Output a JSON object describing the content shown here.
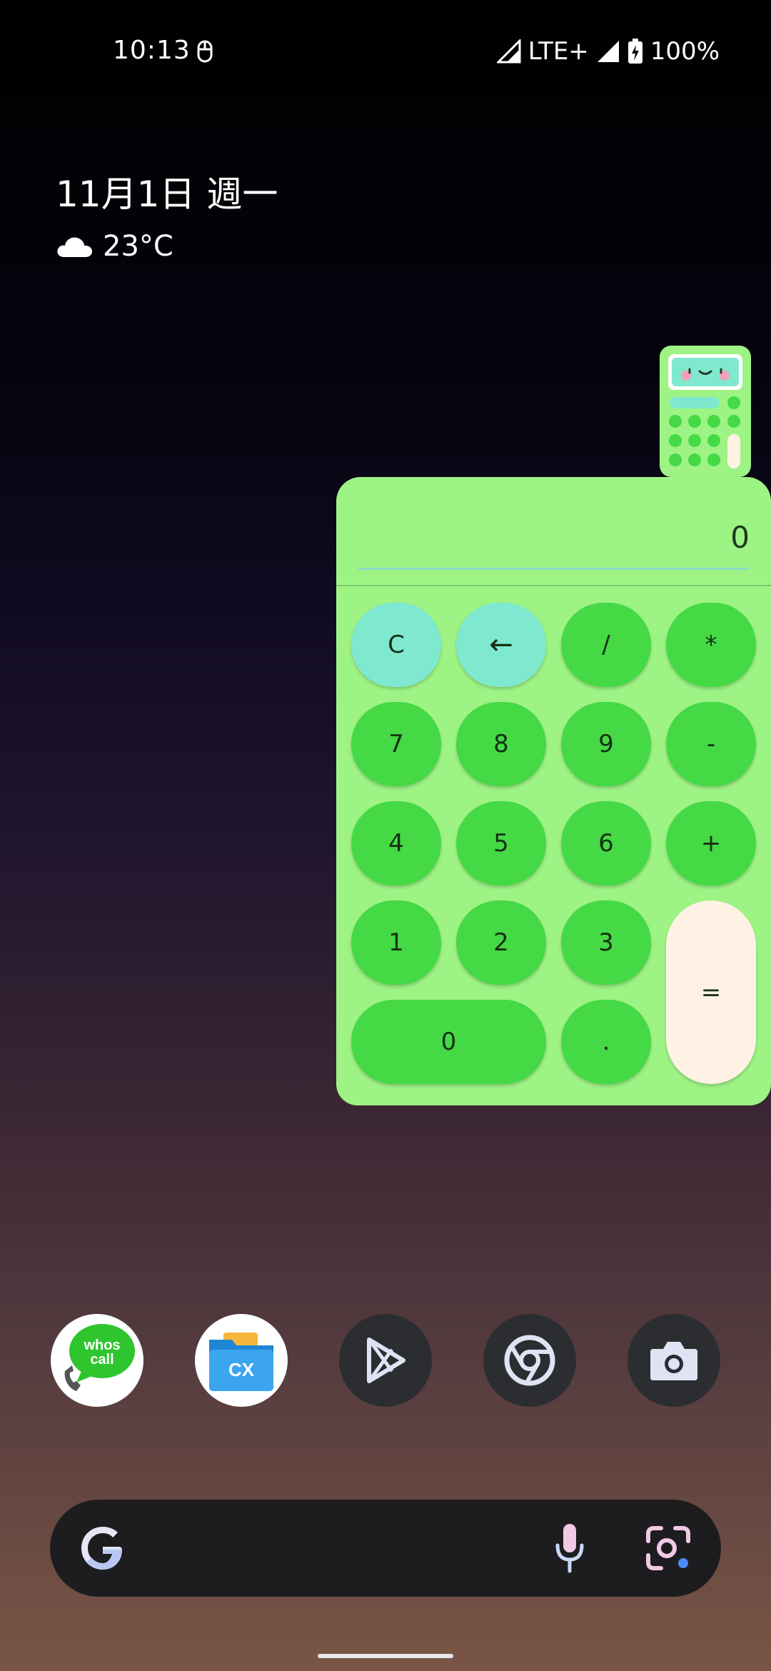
{
  "status_bar": {
    "time": "10:13",
    "network": "LTE+",
    "battery": "100%"
  },
  "glance": {
    "date": "11月1日 週一",
    "temperature": "23°C",
    "weather_icon": "cloud-icon"
  },
  "calculator": {
    "display_value": "0",
    "keys": {
      "clear": "C",
      "backspace": "←",
      "divide": "/",
      "multiply": "*",
      "seven": "7",
      "eight": "8",
      "nine": "9",
      "minus": "-",
      "four": "4",
      "five": "5",
      "six": "6",
      "plus": "+",
      "one": "1",
      "two": "2",
      "three": "3",
      "equals": "=",
      "zero": "0",
      "decimal": "."
    },
    "colors": {
      "panel": "#9ef385",
      "key": "#45d945",
      "key_accent": "#7ee9cf",
      "key_equals": "#fdf2e3"
    }
  },
  "dock": {
    "apps": [
      {
        "icon": "whoscall-icon",
        "text_line1": "whos",
        "text_line2": "call"
      },
      {
        "icon": "file-manager-icon",
        "text": "CX"
      },
      {
        "icon": "play-store-icon"
      },
      {
        "icon": "chrome-icon"
      },
      {
        "icon": "camera-icon"
      }
    ]
  },
  "search_bar": {
    "logo": "google-g-icon",
    "mic": "mic-icon",
    "lens": "lens-icon"
  }
}
